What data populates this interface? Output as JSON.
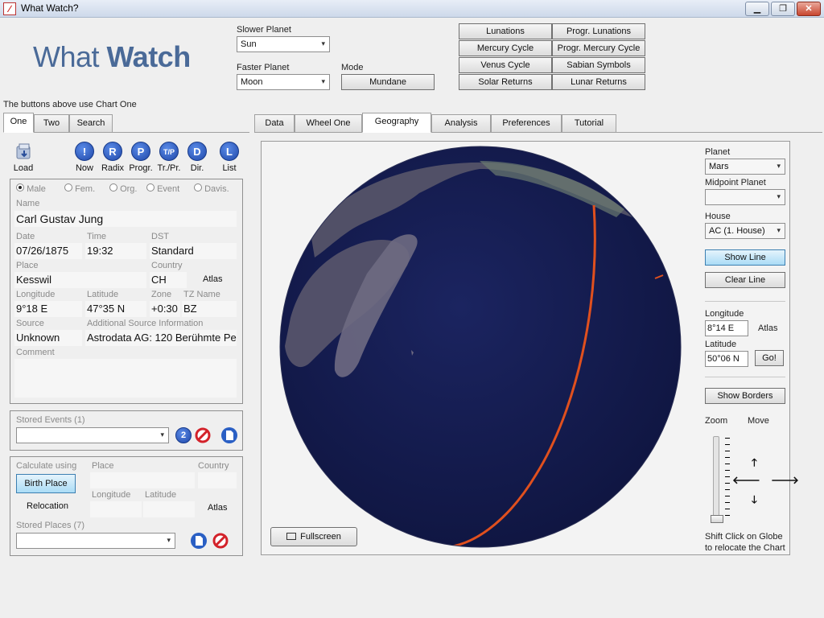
{
  "window": {
    "title": "What Watch?",
    "min": "▁",
    "max": "❐",
    "close": "✕"
  },
  "logo": {
    "part1": "What ",
    "part2": "Watch"
  },
  "header": {
    "slower_planet_label": "Slower Planet",
    "slower_planet_value": "Sun",
    "faster_planet_label": "Faster Planet",
    "faster_planet_value": "Moon",
    "mode_label": "Mode",
    "mode_value": "Mundane",
    "buttons": [
      "Lunations",
      "Progr. Lunations",
      "Mercury Cycle",
      "Progr. Mercury Cycle",
      "Venus Cycle",
      "Sabian Symbols",
      "Solar Returns",
      "Lunar Returns"
    ],
    "hint": "The buttons above use Chart One"
  },
  "left_tabs": [
    "One",
    "Two",
    "Search"
  ],
  "toolbar": {
    "load": "Load",
    "items": [
      {
        "glyph": "!",
        "label": "Now"
      },
      {
        "glyph": "R",
        "label": "Radix"
      },
      {
        "glyph": "P",
        "label": "Progr."
      },
      {
        "glyph": "T/P",
        "label": "Tr./Pr."
      },
      {
        "glyph": "D",
        "label": "Dir."
      },
      {
        "glyph": "L",
        "label": "List"
      }
    ]
  },
  "chart": {
    "radios": [
      "Male",
      "Fem.",
      "Org.",
      "Event",
      "Davis."
    ],
    "name_label": "Name",
    "name": "Carl Gustav Jung",
    "date_label": "Date",
    "date": "07/26/1875",
    "time_label": "Time",
    "time": "19:32",
    "dst_label": "DST",
    "dst": "Standard",
    "place_label": "Place",
    "place": "Kesswil",
    "country_label": "Country",
    "country": "CH",
    "atlas": "Atlas",
    "longitude_label": "Longitude",
    "longitude": "9°18 E",
    "latitude_label": "Latitude",
    "latitude": "47°35 N",
    "zone_label": "Zone",
    "zone": "+0:30",
    "tz_label": "TZ Name",
    "tz": "BZ",
    "source_label": "Source",
    "source": "Unknown",
    "add_source_label": "Additional Source Information",
    "add_source": "Astrodata AG: 120 Berühmte Pe",
    "comment_label": "Comment"
  },
  "stored_events": {
    "label": "Stored Events (1)",
    "two": "2"
  },
  "calc": {
    "label": "Calculate using",
    "birth_place": "Birth Place",
    "relocation": "Relocation",
    "place_label": "Place",
    "country_label": "Country",
    "longitude_label": "Longitude",
    "latitude_label": "Latitude",
    "atlas": "Atlas",
    "stored_places": "Stored Places (7)"
  },
  "main_tabs": [
    "Data",
    "Wheel One",
    "Geography",
    "Analysis",
    "Preferences",
    "Tutorial"
  ],
  "geo": {
    "fullscreen": "Fullscreen",
    "planet_label": "Planet",
    "planet": "Mars",
    "midpoint_label": "Midpoint Planet",
    "midpoint": "",
    "house_label": "House",
    "house": "AC (1. House)",
    "show_line": "Show Line",
    "clear_line": "Clear Line",
    "longitude_label": "Longitude",
    "longitude": "8°14 E",
    "atlas": "Atlas",
    "latitude_label": "Latitude",
    "latitude": "50°06 N",
    "go": "Go!",
    "show_borders": "Show Borders",
    "zoom": "Zoom",
    "move": "Move",
    "hint1": "Shift Click on Globe",
    "hint2": "to relocate the Chart"
  },
  "colors": {
    "ocean": "#141b4d",
    "land": "#5c5a6e",
    "line": "#e0501e",
    "accent": "#4a6a98"
  }
}
